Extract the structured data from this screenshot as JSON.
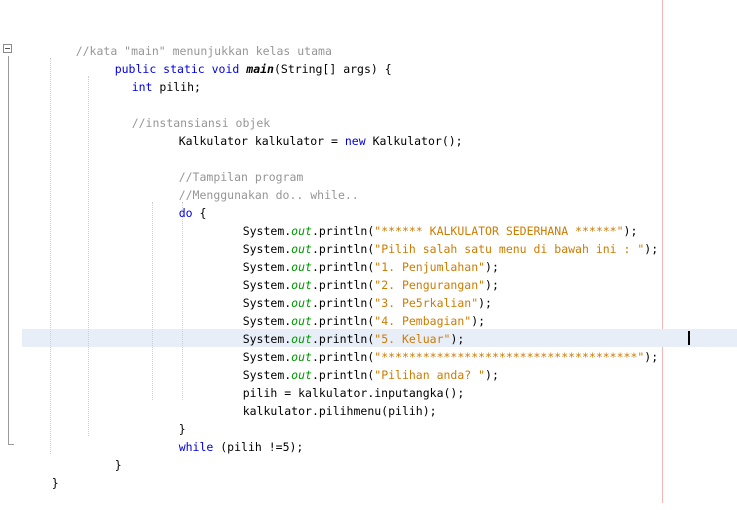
{
  "code": {
    "l1": {
      "comment": "//kata \"main\" menunjukkan kelas utama"
    },
    "l2": {
      "kw1": "public static void",
      "method": "main",
      "rest": "(String[] args) {"
    },
    "l3": {
      "kw": "int",
      "rest": " pilih;"
    },
    "l4": {
      "comment": "//instansiansi objek"
    },
    "l5": {
      "a": "Kalkulator kalkulator = ",
      "kw": "new",
      "b": " Kalkulator();"
    },
    "l6": {
      "comment": "//Tampilan program"
    },
    "l7": {
      "comment": "//Menggunakan do.. while.."
    },
    "l8": {
      "kw": "do",
      "rest": " {"
    },
    "prints": [
      {
        "sys": "System.",
        "field": "out",
        "call": ".println(",
        "str": "\"****** KALKULATOR SEDERHANA ******\"",
        "end": ");"
      },
      {
        "sys": "System.",
        "field": "out",
        "call": ".println(",
        "str": "\"Pilih salah satu menu di bawah ini : \"",
        "end": ");"
      },
      {
        "sys": "System.",
        "field": "out",
        "call": ".println(",
        "str": "\"1. Penjumlahan\"",
        "end": ");"
      },
      {
        "sys": "System.",
        "field": "out",
        "call": ".println(",
        "str": "\"2. Pengurangan\"",
        "end": ");"
      },
      {
        "sys": "System.",
        "field": "out",
        "call": ".println(",
        "str": "\"3. Pe5rkalian\"",
        "end": ");"
      },
      {
        "sys": "System.",
        "field": "out",
        "call": ".println(",
        "str": "\"4. Pembagian\"",
        "end": ");"
      },
      {
        "sys": "System.",
        "field": "out",
        "call": ".println(",
        "str": "\"5. Keluar\"",
        "end": ");"
      },
      {
        "sys": "System.",
        "field": "out",
        "call": ".println(",
        "str": "\"*************************************\"",
        "end": ");"
      },
      {
        "sys": "System.",
        "field": "out",
        "call": ".println(",
        "str": "\"Pilihan anda? \"",
        "end": ");"
      }
    ],
    "l18": "pilih = kalkulator.inputangka();",
    "l19": "kalkulator.pilihmenu(pilih);",
    "l20": "}",
    "l21": {
      "kw": "while",
      "rest": " (pilih !=5);"
    },
    "l22": "}",
    "l23": "}"
  }
}
